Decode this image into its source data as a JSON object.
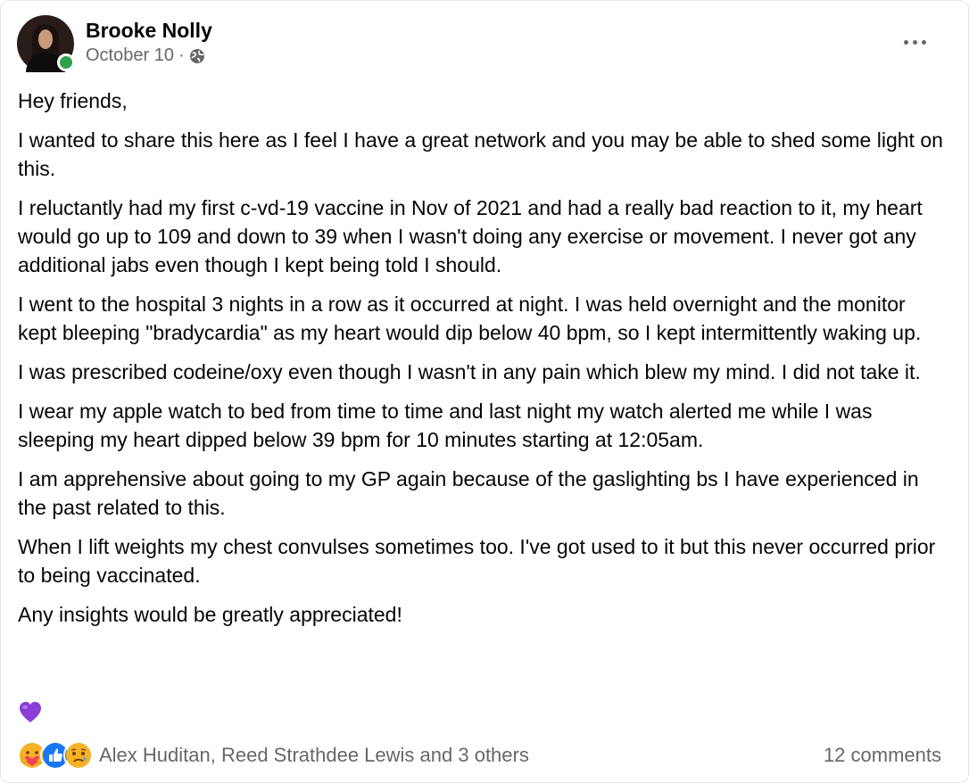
{
  "post": {
    "author": "Brooke Nolly",
    "date": "October 10",
    "date_separator": "·",
    "privacy_icon": "globe-icon",
    "more_icon": "more-options-icon",
    "paragraphs": [
      "Hey friends,",
      "I wanted to share this here as I feel I have a great network and you may be able to shed some light on this.",
      "I reluctantly had my first c-vd-19 vaccine in Nov of 2021 and had a really bad reaction to it, my heart would go up to 109 and down to 39 when I wasn't doing any exercise or movement. I never got any additional jabs even though I kept being told I should.",
      "I went to the hospital 3 nights in a row as it occurred at night. I was held overnight and the monitor kept bleeping \"bradycardia\" as my heart would dip below 40 bpm, so I kept intermittently waking up.",
      "I was prescribed codeine/oxy even though I wasn't in any pain which blew my mind. I did not take it.",
      "I wear my apple watch to bed from time to time and last night my watch alerted me while I was sleeping my heart dipped below 39 bpm for 10 minutes starting at 12:05am.",
      "I am apprehensive about going to my GP again because of the gaslighting bs I have experienced in the past related to this.",
      "When I lift weights my chest convulses sometimes too. I've got used to it but this never occurred prior to being vaccinated.",
      "Any insights would be greatly appreciated!"
    ],
    "emoji": "purple-heart-emoji"
  },
  "footer": {
    "reaction_icons": [
      "care-reaction-icon",
      "like-reaction-icon",
      "sad-reaction-icon"
    ],
    "reaction_names": "Alex Huditan, Reed Strathdee Lewis and 3 others",
    "comments": "12 comments"
  },
  "colors": {
    "online": "#31a24c",
    "like_blue": "#1877f2",
    "secondary_text": "#65676b",
    "heart_purple": "#8b3dd8"
  }
}
